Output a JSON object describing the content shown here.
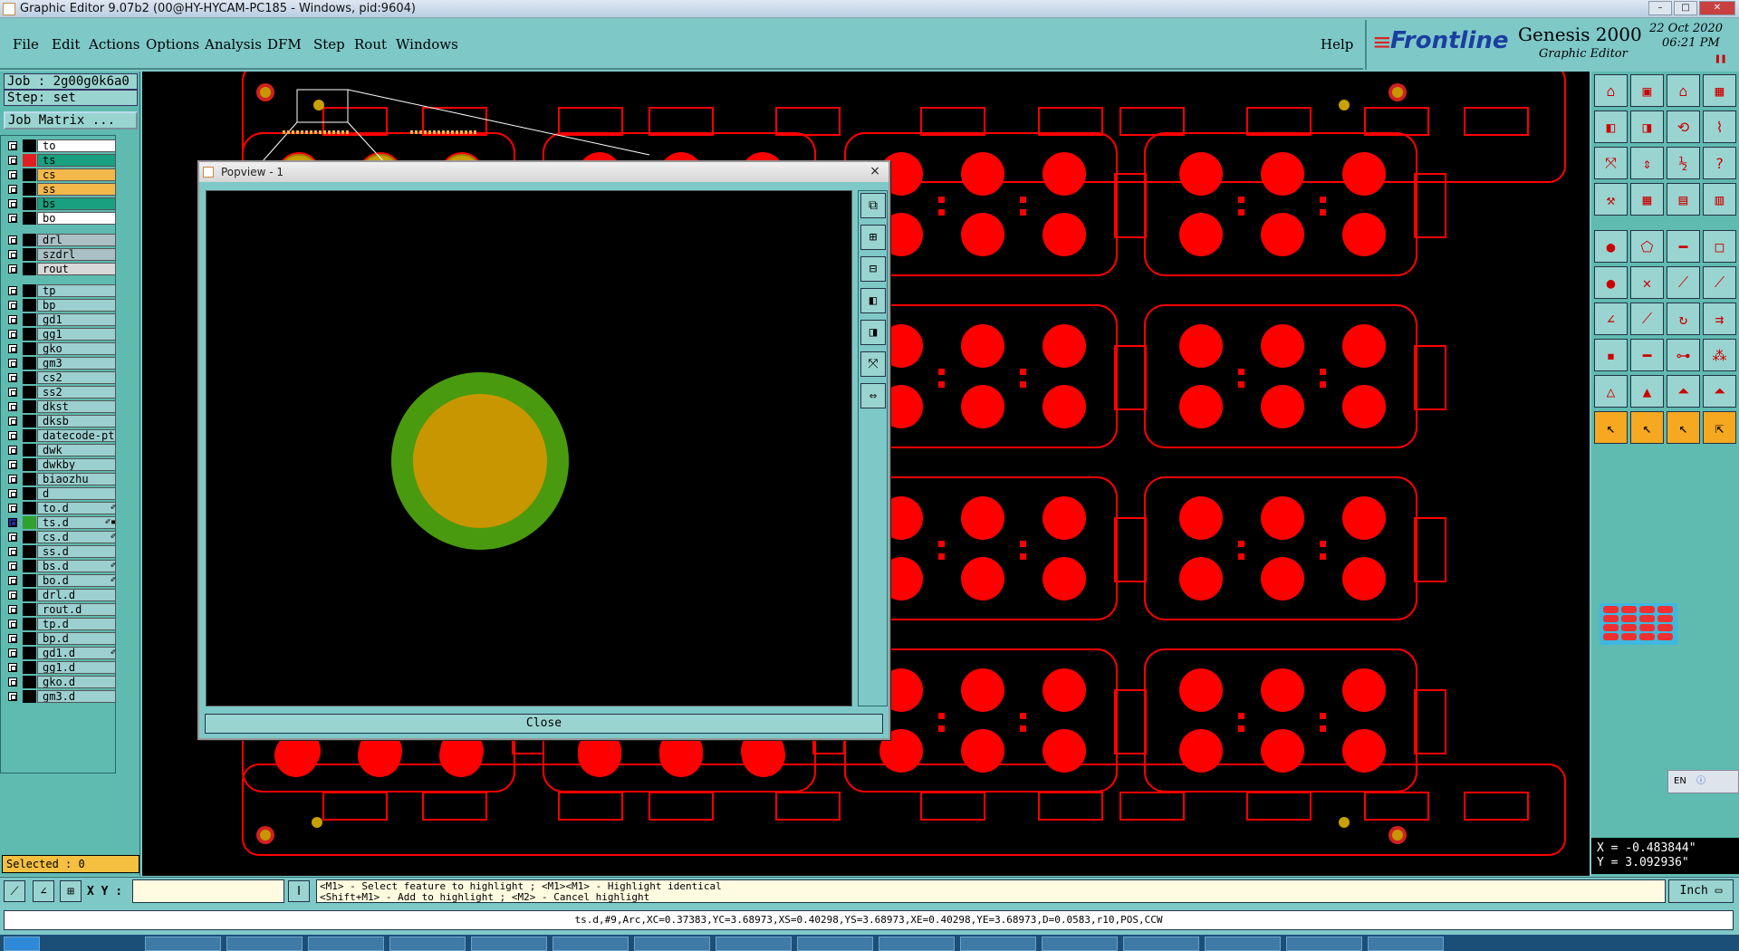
{
  "window": {
    "title": "Graphic Editor 9.07b2 (00@HY-HYCAM-PC185 - Windows, pid:9604)"
  },
  "menu": [
    "File",
    "Edit",
    "Actions",
    "Options",
    "Analysis",
    "DFM",
    "Step",
    "Rout",
    "Windows"
  ],
  "help_label": "Help",
  "brand": {
    "logo": "Frontline",
    "product": "Genesis 2000",
    "subtitle": "Graphic Editor",
    "date": "22 Oct 2020",
    "time": "06:21 PM"
  },
  "job": {
    "job_line": "Job : 2g00g0k6a0",
    "step_line": "Step: set",
    "matrix_button": "Job Matrix ..."
  },
  "layers": [
    {
      "name": "to",
      "style": "white",
      "color": "#000000"
    },
    {
      "name": "ts",
      "style": "green",
      "color": "#e02020"
    },
    {
      "name": "cs",
      "style": "orange",
      "color": "#000000"
    },
    {
      "name": "ss",
      "style": "orange",
      "color": "#000000"
    },
    {
      "name": "bs",
      "style": "green",
      "color": "#000000"
    },
    {
      "name": "bo",
      "style": "white",
      "color": "#000000"
    },
    {
      "name": "drl",
      "style": "grey",
      "color": "#000000"
    },
    {
      "name": "szdrl",
      "style": "grey",
      "color": "#000000"
    },
    {
      "name": "rout",
      "style": "light",
      "color": "#000000"
    },
    {
      "name": "tp",
      "style": "",
      "color": "#000000"
    },
    {
      "name": "bp",
      "style": "",
      "color": "#000000"
    },
    {
      "name": "gd1",
      "style": "",
      "color": "#000000"
    },
    {
      "name": "gg1",
      "style": "",
      "color": "#000000"
    },
    {
      "name": "gko",
      "style": "",
      "color": "#000000"
    },
    {
      "name": "gm3",
      "style": "",
      "color": "#000000"
    },
    {
      "name": "cs2",
      "style": "",
      "color": "#000000"
    },
    {
      "name": "ss2",
      "style": "",
      "color": "#000000"
    },
    {
      "name": "dkst",
      "style": "",
      "color": "#000000"
    },
    {
      "name": "dksb",
      "style": "",
      "color": "#000000"
    },
    {
      "name": "datecode-ptc",
      "style": "",
      "color": "#000000"
    },
    {
      "name": "dwk",
      "style": "",
      "color": "#000000"
    },
    {
      "name": "dwkby",
      "style": "",
      "color": "#000000"
    },
    {
      "name": "biaozhu",
      "style": "",
      "color": "#000000"
    },
    {
      "name": "d",
      "style": "",
      "color": "#000000"
    },
    {
      "name": "to.d",
      "style": "",
      "color": "#000000",
      "edit": "✐"
    },
    {
      "name": "ts.d",
      "style": "",
      "color": "#30a030",
      "edit": "✐▪",
      "active": true
    },
    {
      "name": "cs.d",
      "style": "",
      "color": "#000000",
      "edit": "✐"
    },
    {
      "name": "ss.d",
      "style": "",
      "color": "#000000"
    },
    {
      "name": "bs.d",
      "style": "",
      "color": "#000000",
      "edit": "✐"
    },
    {
      "name": "bo.d",
      "style": "",
      "color": "#000000",
      "edit": "✐"
    },
    {
      "name": "drl.d",
      "style": "",
      "color": "#000000"
    },
    {
      "name": "rout.d",
      "style": "",
      "color": "#000000"
    },
    {
      "name": "tp.d",
      "style": "",
      "color": "#000000"
    },
    {
      "name": "bp.d",
      "style": "",
      "color": "#000000"
    },
    {
      "name": "gd1.d",
      "style": "",
      "color": "#000000",
      "edit": "✐"
    },
    {
      "name": "gg1.d",
      "style": "",
      "color": "#000000"
    },
    {
      "name": "gko.d",
      "style": "",
      "color": "#000000"
    },
    {
      "name": "gm3.d",
      "style": "",
      "color": "#000000"
    }
  ],
  "popview": {
    "title": "Popview - 1",
    "close_x": "×",
    "close_button": "Close"
  },
  "selected": "Selected : 0",
  "xy_label": "X Y :",
  "xy_value": "",
  "hint_line1": "<M1> - Select feature to highlight ; <M1><M1> - Highlight identical",
  "hint_line2": "<Shift+M1> - Add to highlight ; <M2> - Cancel highlight",
  "unit": "Inch",
  "status": "ts.d,#9,Arc,XC=0.37383,YC=3.68973,XS=0.40298,YS=3.68973,XE=0.40298,YE=3.68973,D=0.0583,r10,POS,CCW",
  "coords": {
    "x": "X = -0.483844\"",
    "y": "Y = 3.092936\""
  },
  "lang": "EN",
  "colors": {
    "pcb_red": "#ff0000",
    "pad_outer": "#4a9a10",
    "pad_inner": "#c89600",
    "panel": "#7ec8c8"
  }
}
